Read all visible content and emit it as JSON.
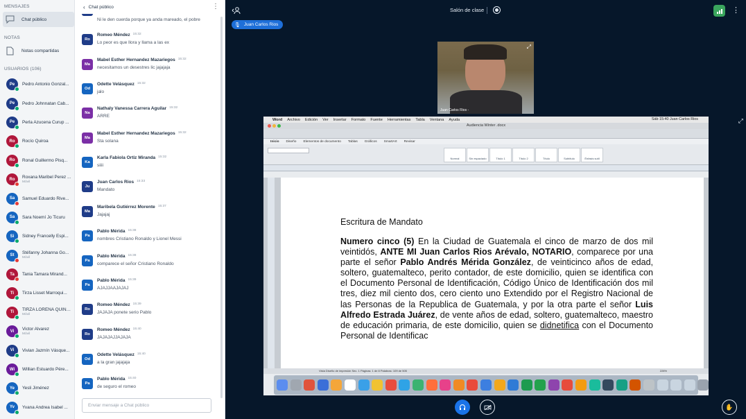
{
  "sidebar": {
    "messages_title": "MENSAJES",
    "public_chat": "Chat público",
    "notes_title": "NOTAS",
    "shared_notes": "Notas compartidas",
    "users_title": "USUARIOS (106)",
    "users": [
      {
        "initials": "Pe",
        "name": "Pedro Antonio Gonzal...",
        "sub": "",
        "color": "#1f3c88",
        "dot": "#00a86b"
      },
      {
        "initials": "Pe",
        "name": "Pedro Johnnatan Cab...",
        "sub": "",
        "color": "#1f3c88",
        "dot": "#00a86b"
      },
      {
        "initials": "Pe",
        "name": "Perla Azucena Curup ...",
        "sub": "",
        "color": "#1f3c88",
        "dot": "#00a86b"
      },
      {
        "initials": "Ro",
        "name": "Rocío Quiroa",
        "sub": "",
        "color": "#b0173b",
        "dot": "#00a86b"
      },
      {
        "initials": "Ro",
        "name": "Ronal Guillermo Pisq...",
        "sub": "",
        "color": "#b0173b",
        "dot": "#00a86b"
      },
      {
        "initials": "Ro",
        "name": "Roxana Maribel Perez ...",
        "sub": "Móvil",
        "color": "#b0173b",
        "dot": "#e53935"
      },
      {
        "initials": "Sa",
        "name": "Samuel Eduardo Rive...",
        "sub": "",
        "color": "#1565c0",
        "dot": "#e53935"
      },
      {
        "initials": "Sa",
        "name": "Sara Noemí Jo Ticuru",
        "sub": "",
        "color": "#1565c0",
        "dot": "#00a86b"
      },
      {
        "initials": "Si",
        "name": "Sidney Francelly Espi...",
        "sub": "",
        "color": "#1565c0",
        "dot": "#00a86b"
      },
      {
        "initials": "St",
        "name": "Stéfanny Johanna Go...",
        "sub": "Móvil",
        "color": "#1565c0",
        "dot": "#e53935"
      },
      {
        "initials": "Ta",
        "name": "Tania Tamara Mirand...",
        "sub": "",
        "color": "#b0173b",
        "dot": "#e53935"
      },
      {
        "initials": "Ti",
        "name": "Tirza Lisset Marroqui...",
        "sub": "",
        "color": "#b0173b",
        "dot": "#00a86b"
      },
      {
        "initials": "Ti",
        "name": "TIRZA LORENA QUINT...",
        "sub": "Móvil",
        "color": "#b0173b",
        "dot": "#00a86b"
      },
      {
        "initials": "Vi",
        "name": "Victor Alvarez",
        "sub": "Móvil",
        "color": "#6a1b9a",
        "dot": "#00a86b"
      },
      {
        "initials": "Vi",
        "name": "Vivian Jazmín Vásque...",
        "sub": "",
        "color": "#1f3c88",
        "dot": "#00a86b"
      },
      {
        "initials": "Wi",
        "name": "Willian Estuardo Pére...",
        "sub": "",
        "color": "#6a1b9a",
        "dot": "#00a86b"
      },
      {
        "initials": "Ye",
        "name": "Yesli Jiménez",
        "sub": "",
        "color": "#1565c0",
        "dot": "#00a86b"
      },
      {
        "initials": "Yv",
        "name": "Yvana Andrea Isabel ...",
        "sub": "",
        "color": "#1565c0",
        "dot": "#00a86b"
      }
    ]
  },
  "chat": {
    "back_label": "Chat público",
    "top_text": "Ni le den cuerda porque ya anda mareado, el pobre",
    "messages": [
      {
        "initials": "Ro",
        "color": "#1f3c88",
        "name": "Romeo Méndez",
        "time": "15:32",
        "text": "Lo peor es que llora y llama a las ex"
      },
      {
        "initials": "Ma",
        "color": "#7b2fa6",
        "name": "Mabel Esther Hernandez Mazariegos",
        "time": "15:32",
        "text": "necesitamos un desestres lic jajajaja"
      },
      {
        "initials": "Od",
        "color": "#1565c0",
        "name": "Odette Velásquez",
        "time": "15:32",
        "text": "jalo"
      },
      {
        "initials": "Na",
        "color": "#7b2fa6",
        "name": "Nathaly Vanessa Carrera Aguilar",
        "time": "15:32",
        "text": "ARRE"
      },
      {
        "initials": "Ma",
        "color": "#7b2fa6",
        "name": "Mabel Esther Hernandez Mazariegos",
        "time": "15:32",
        "text": "Sta solana"
      },
      {
        "initials": "Ka",
        "color": "#1565c0",
        "name": "Karla Fabiola Ortiz Miranda",
        "time": "15:32",
        "text": "siiii"
      },
      {
        "initials": "Ju",
        "color": "#1f3c88",
        "name": "Juan Carlos Rios",
        "time": "15:33",
        "text": "Mandato"
      },
      {
        "initials": "Ma",
        "color": "#1f3c88",
        "name": "Maribela Gutiérrez Morente",
        "time": "15:37",
        "text": "Jajajaj"
      },
      {
        "initials": "Pa",
        "color": "#1565c0",
        "name": "Pablo Mérida",
        "time": "15:38",
        "text": "nombres Cristiano Ronaldo y Lionel Messi"
      },
      {
        "initials": "Pa",
        "color": "#1565c0",
        "name": "Pablo Mérida",
        "time": "15:38",
        "text": "comparece el señor Cristiano Ronaldo"
      },
      {
        "initials": "Pa",
        "color": "#1565c0",
        "name": "Pablo Mérida",
        "time": "15:39",
        "text": "AJAJJAAJAJAJ"
      },
      {
        "initials": "Ro",
        "color": "#1f3c88",
        "name": "Romeo Méndez",
        "time": "15:39",
        "text": "JAJAJA ponete serio Pablo"
      },
      {
        "initials": "Ro",
        "color": "#1f3c88",
        "name": "Romeo Méndez",
        "time": "15:40",
        "text": "JAJAJAJJAJAJA"
      },
      {
        "initials": "Od",
        "color": "#1565c0",
        "name": "Odette Velásquez",
        "time": "15:40",
        "text": "a la gran jajajaja"
      },
      {
        "initials": "Pa",
        "color": "#1565c0",
        "name": "Pablo Mérida",
        "time": "15:40",
        "text": "de seguro el romeo"
      }
    ],
    "input_placeholder": "Enviar mensaje a Chat público"
  },
  "main": {
    "room_title": "Salón de clase",
    "presenter": "Juan Carlos Rios",
    "webcam_name": "Juan Carlos Rios -"
  },
  "word": {
    "menubar": [
      "Word",
      "Archivo",
      "Edición",
      "Ver",
      "Insertar",
      "Formato",
      "Fuente",
      "Herramientas",
      "Tabla",
      "Ventana",
      "Ayuda"
    ],
    "menubar_right": "Sáb 15:40  Juan Carlos Rios",
    "doc_title": "Audiencia Winter .docx",
    "tabs": [
      "Inicio",
      "Diseño",
      "Elementos de documento",
      "Tablas",
      "Gráficos",
      "SmartArt",
      "Revisar"
    ],
    "styles": [
      "Normal",
      "Sin espaciado",
      "Título 1",
      "Título 2",
      "Título",
      "Subtítulo",
      "Énfasis sutil"
    ],
    "heading": "Escritura de Mandato",
    "paragraph_html": "<b>Numero cinco (5)</b> En la Ciudad de Guatemala el cinco de marzo de dos mil veintidós, <b>ANTE MI Juan Carlos Rios Arévalo, NOTARIO</b>, comparece por una parte el señor <b>Pablo Andrés Mérida González</b>, de veinticinco años de edad, soltero, guatemalteco, perito contador, de este domicilio, quien se identifica con el Documento Personal de Identificación, Código Único de Identificación dos mil tres, diez mil ciento dos, cero ciento uno Extendido por el Registro Nacional de las Personas de la Republica de Guatemala, y por la otra parte el señor <b>Luis Alfredo Estrada Juárez</b>, de vente años de edad, soltero, guatemalteco, maestro de educación primaria, de este domicilio, quien se <u>didnetifica</u> con el Documento Personal de Identificac",
    "status": "Vista Diseño de impresión    Sec. 1    Páginas: 1 de 8    Palabras: 109 de 505",
    "zoom": "228%"
  }
}
